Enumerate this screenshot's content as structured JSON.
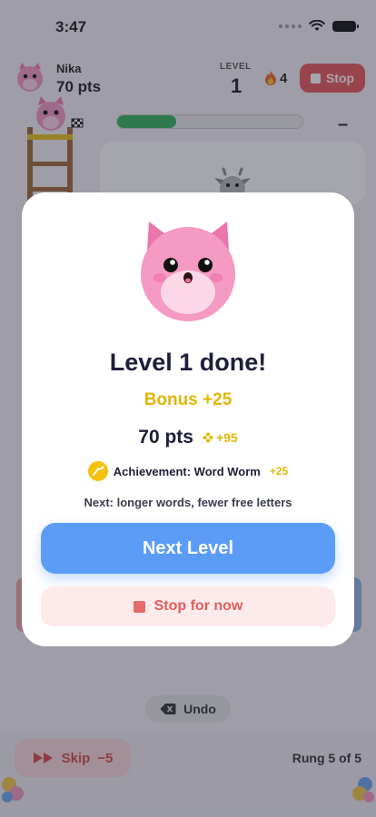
{
  "status_bar": {
    "time": "3:47"
  },
  "header": {
    "player_name": "Nika",
    "player_points": "70 pts",
    "level_label": "LEVEL",
    "level_value": "1",
    "streak_count": "4",
    "stop_label": "Stop"
  },
  "game": {
    "progress_fraction": 0.32,
    "collapse_symbol": "–",
    "undo_label": "Undo",
    "skip_label": "Skip",
    "skip_cost": "−5",
    "rung_text": "Rung 5 of 5"
  },
  "modal": {
    "title": "Level 1 done!",
    "bonus": "Bonus +25",
    "points": "70 pts",
    "points_gain": "+95",
    "achievement": "Achievement: Word Worm",
    "achievement_bonus": "+25",
    "next_hint": "Next: longer words, fewer free letters",
    "next_button": "Next Level",
    "stop_button": "Stop for now"
  },
  "colors": {
    "accent_blue": "#5b9cf6",
    "stop_red": "#e8595a",
    "bonus_gold": "#e2b606",
    "progress_green": "#33b35a",
    "mascot_pink": "#f59ac3"
  },
  "icons": [
    "wifi-icon",
    "battery-icon",
    "flame-icon",
    "stop-square-icon",
    "cat-avatar-icon",
    "ladder-icon",
    "finish-flag-icon",
    "cow-icon",
    "sparkle-icon",
    "achievement-badge-icon",
    "backspace-icon",
    "skip-arrows-icon"
  ]
}
